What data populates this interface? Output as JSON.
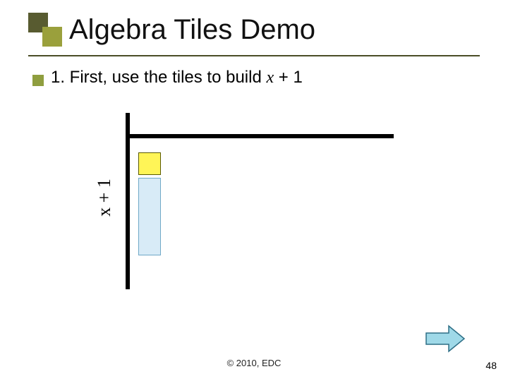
{
  "title": "Algebra Tiles Demo",
  "step": {
    "prefix": "1. First, use the tiles to build ",
    "italic": "x",
    "suffix": "  + 1"
  },
  "axis_label": "x + 1",
  "footer": "© 2010, EDC",
  "page_number": "48",
  "icons": {
    "nav": "right-arrow-icon"
  },
  "colors": {
    "accent_dark": "#585b30",
    "accent_light": "#9aa03c",
    "tile_unit": "#fff557",
    "tile_x": "#d8ebf7",
    "arrow_fill": "#9fd9e8",
    "arrow_stroke": "#2e6f86"
  },
  "chart_data": {
    "type": "bar",
    "title": "",
    "xlabel": "",
    "ylabel": "x + 1",
    "categories": [
      "unit",
      "x"
    ],
    "values": [
      1,
      1
    ],
    "ylim": [
      0,
      1
    ],
    "annotations": [
      "yellow unit tile (1)",
      "blue x tile"
    ]
  }
}
